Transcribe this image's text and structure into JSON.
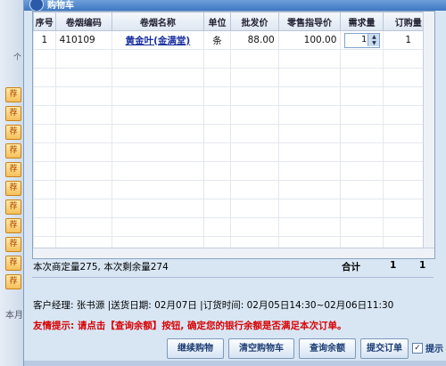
{
  "window": {
    "title": "购物车"
  },
  "left_panel": {
    "label_top": "个",
    "label_bottom": "本月",
    "hot_tag": "荐"
  },
  "table": {
    "headers": [
      "序号",
      "卷烟编码",
      "卷烟名称",
      "单位",
      "批发价",
      "零售指导价",
      "需求量",
      "订购量"
    ],
    "rows": [
      {
        "index": "1",
        "code": "410109",
        "name": "黄金叶(金满堂)",
        "unit": "条",
        "wholesale": "88.00",
        "retail": "100.00",
        "demand": "1",
        "order": "1"
      }
    ]
  },
  "summary": {
    "quota_text": "本次商定量275, 本次剩余量274",
    "total_label": "合计",
    "total_demand": "1",
    "total_order": "1"
  },
  "info": {
    "manager_line": "客户经理: 张书源 |送货日期: 02月07日 |订货时间: 02月05日14:30~02月06日11:30"
  },
  "hint": {
    "text": "友情提示: 请点击【查询余额】按钮, 确定您的银行余额是否满足本次订单。"
  },
  "buttons": {
    "continue": "继续购物",
    "clear": "清空购物车",
    "balance": "查询余额",
    "submit": "提交订单",
    "prompt": "提示"
  },
  "colors": {
    "hint": "#d80000",
    "link": "#1a2fa0",
    "title_bar": "#3f78c4"
  }
}
